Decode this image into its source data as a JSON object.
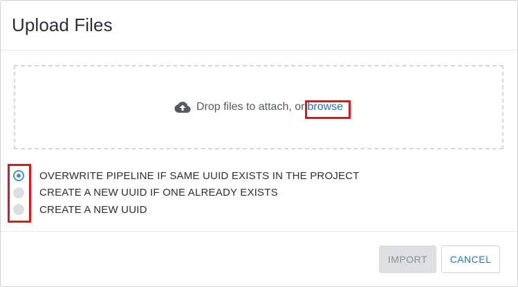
{
  "dialog": {
    "title": "Upload Files"
  },
  "dropzone": {
    "icon": "cloud-upload-icon",
    "prompt": "Drop files to attach, or",
    "browse_label": "browse"
  },
  "options": {
    "selected_index": 0,
    "items": [
      {
        "label": "OVERWRITE PIPELINE IF SAME UUID EXISTS IN THE PROJECT",
        "checked": true
      },
      {
        "label": "CREATE A NEW UUID IF ONE ALREADY EXISTS",
        "checked": false
      },
      {
        "label": "CREATE A NEW UUID",
        "checked": false
      }
    ]
  },
  "footer": {
    "import_label": "IMPORT",
    "cancel_label": "CANCEL"
  },
  "colors": {
    "accent": "#1f79a8",
    "radio_selected": "#4a8ec8",
    "highlight": "#e0151f"
  }
}
